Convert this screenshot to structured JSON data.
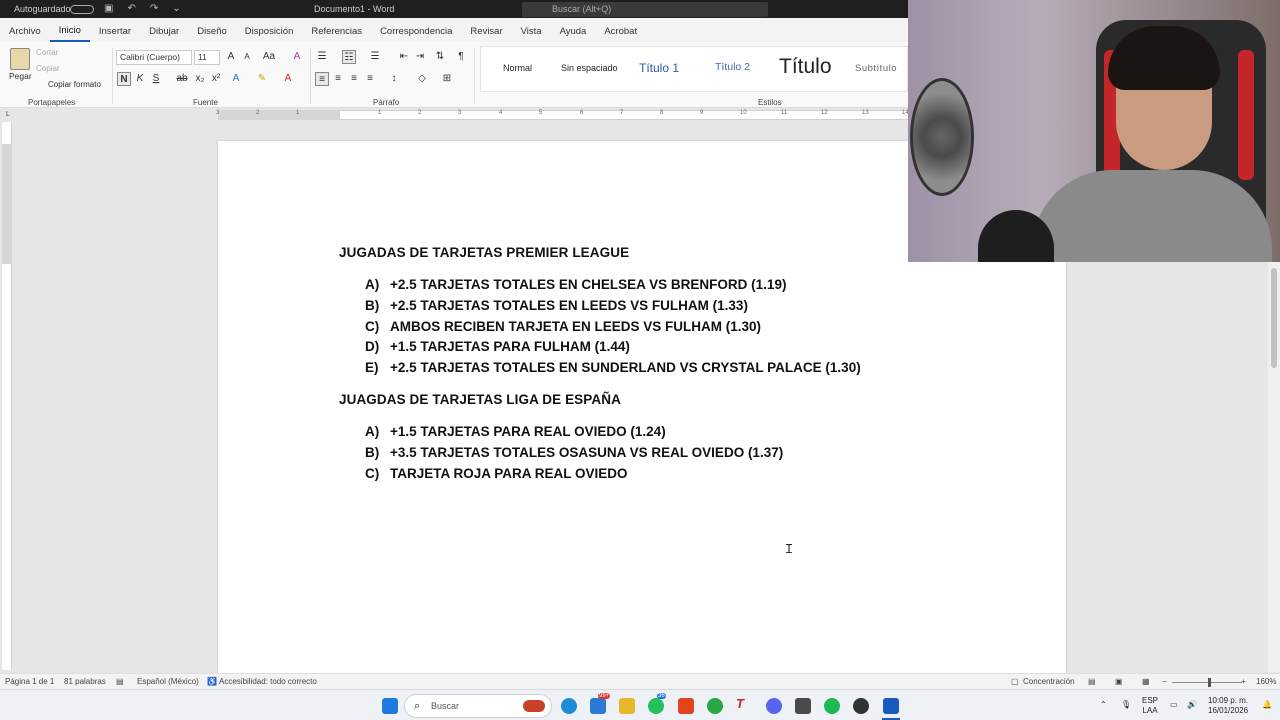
{
  "titlebar": {
    "autosave": "Autoguardado",
    "document": "Documento1 - Word",
    "search_placeholder": "Buscar (Alt+Q)"
  },
  "tabs": [
    "Archivo",
    "Inicio",
    "Insertar",
    "Dibujar",
    "Diseño",
    "Disposición",
    "Referencias",
    "Correspondencia",
    "Revisar",
    "Vista",
    "Ayuda",
    "Acrobat"
  ],
  "active_tab": "Inicio",
  "ribbon": {
    "paste": "Pegar",
    "cut": "Cortar",
    "copy": "Copiar",
    "format_painter": "Copiar formato",
    "font_name": "Calibri (Cuerpo)",
    "font_size": "11",
    "groups": {
      "clipboard": "Portapapeles",
      "font": "Fuente",
      "paragraph": "Párrafo",
      "styles": "Estilos"
    },
    "styles": [
      "Normal",
      "Sin espaciado",
      "Título 1",
      "Título 2",
      "Título",
      "Subtítulo"
    ]
  },
  "ruler_ticks": [
    "3",
    "2",
    "1",
    "1",
    "2",
    "3",
    "4",
    "5",
    "6",
    "7",
    "8",
    "9",
    "10",
    "11",
    "12",
    "13",
    "14"
  ],
  "document": {
    "heading1": "JUGADAS DE TARJETAS PREMIER LEAGUE",
    "list1": [
      {
        "marker": "A)",
        "text": "+2.5 TARJETAS TOTALES EN CHELSEA VS BRENFORD (1.19)"
      },
      {
        "marker": "B)",
        "text": "+2.5 TARJETAS TOTALES EN LEEDS VS FULHAM (1.33)"
      },
      {
        "marker": "C)",
        "text": "AMBOS RECIBEN TARJETA EN LEEDS VS FULHAM (1.30)"
      },
      {
        "marker": "D)",
        "text": "+1.5 TARJETAS PARA FULHAM (1.44)"
      },
      {
        "marker": "E)",
        "text": "+2.5 TARJETAS TOTALES EN SUNDERLAND VS CRYSTAL PALACE (1.30)"
      }
    ],
    "heading2": "JUAGDAS DE TARJETAS LIGA DE ESPAÑA",
    "list2": [
      {
        "marker": "A)",
        "text": "+1.5 TARJETAS PARA REAL OVIEDO (1.24)"
      },
      {
        "marker": "B)",
        "text": "+3.5 TARJETAS TOTALES OSASUNA VS REAL OVIEDO (1.37)"
      },
      {
        "marker": "C)",
        "text": "TARJETA ROJA PARA REAL OVIEDO"
      }
    ]
  },
  "status": {
    "page": "Página 1 de 1",
    "words": "81 palabras",
    "language": "Español (México)",
    "accessibility": "Accesibilidad: todo correcto",
    "focus": "Concentración",
    "zoom": "160%"
  },
  "taskbar": {
    "search": "Buscar",
    "lang1": "ESP",
    "lang2": "LAA",
    "time": "10:09 p. m.",
    "date": "16/01/2026",
    "badge1": "99+",
    "badge2": "36"
  },
  "colors": {
    "word_blue": "#185abd",
    "titlebar": "#1f1f1f"
  }
}
